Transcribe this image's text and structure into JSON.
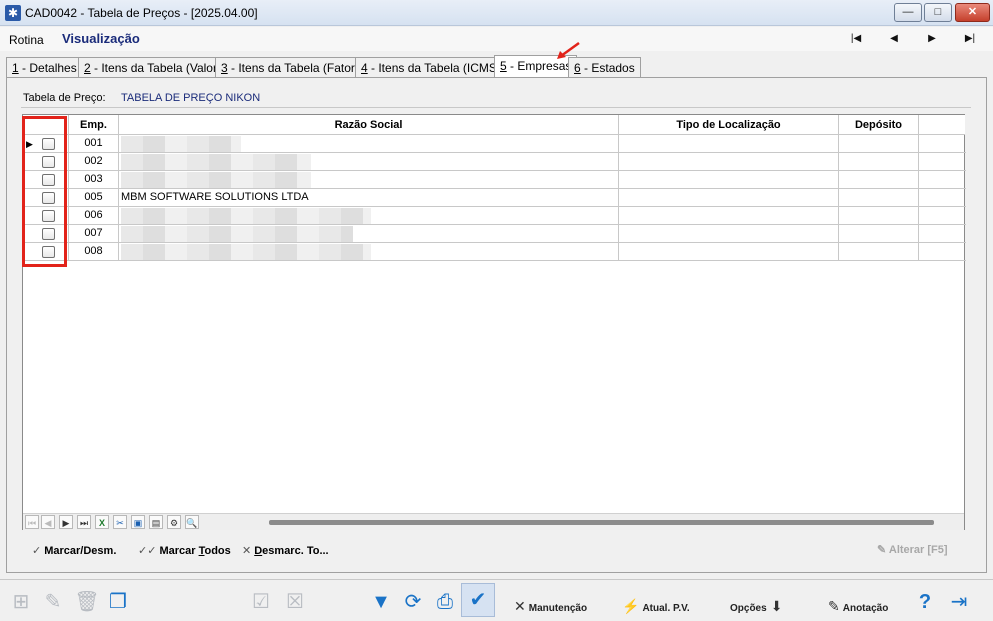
{
  "window": {
    "title": "CAD0042 - Tabela de Preços - [2025.04.00]",
    "min": "—",
    "max": "□",
    "close": "✕"
  },
  "menu": {
    "rotina": "Rotina",
    "visualizacao": "Visualização"
  },
  "nav": {
    "first": "|◀",
    "prev": "◀",
    "next": "▶",
    "last": "▶|"
  },
  "tabs": [
    {
      "num": "1",
      "label": " - Detalhes"
    },
    {
      "num": "2",
      "label": " - Itens da Tabela (Valor)"
    },
    {
      "num": "3",
      "label": " - Itens da Tabela (Fator)"
    },
    {
      "num": "4",
      "label": " - Itens da Tabela (ICMS)"
    },
    {
      "num": "5",
      "label": " - Empresas"
    },
    {
      "num": "6",
      "label": " - Estados"
    }
  ],
  "tabela": {
    "label": "Tabela de Preço:",
    "value": "TABELA DE PREÇO NIKON"
  },
  "grid": {
    "columns": [
      "Emp.",
      "Razão Social",
      "Tipo de Localização",
      "Depósito"
    ],
    "rows": [
      {
        "emp": "001",
        "razao": ""
      },
      {
        "emp": "002",
        "razao": ""
      },
      {
        "emp": "003",
        "razao": ""
      },
      {
        "emp": "005",
        "razao": "MBM SOFTWARE SOLUTIONS LTDA"
      },
      {
        "emp": "006",
        "razao": ""
      },
      {
        "emp": "007",
        "razao": ""
      },
      {
        "emp": "008",
        "razao": ""
      }
    ]
  },
  "actions": {
    "marcar": "Marcar/Desm.",
    "marcar_todos_pre": "Marcar ",
    "marcar_todos_u": "T",
    "marcar_todos_post": "odos",
    "desmarc_u": "D",
    "desmarc_post": "esmarc. To...",
    "alterar": "Alterar [F5]"
  },
  "toolbar": {
    "manutencao": "Manutenção",
    "atual": "Atual. P.V.",
    "opcoes": "Opções",
    "anotacao": "Anotação"
  },
  "colors": {
    "accent": "#1a73c7",
    "highlight_red": "#e2231a",
    "title_blue": "#1a2b7a"
  }
}
